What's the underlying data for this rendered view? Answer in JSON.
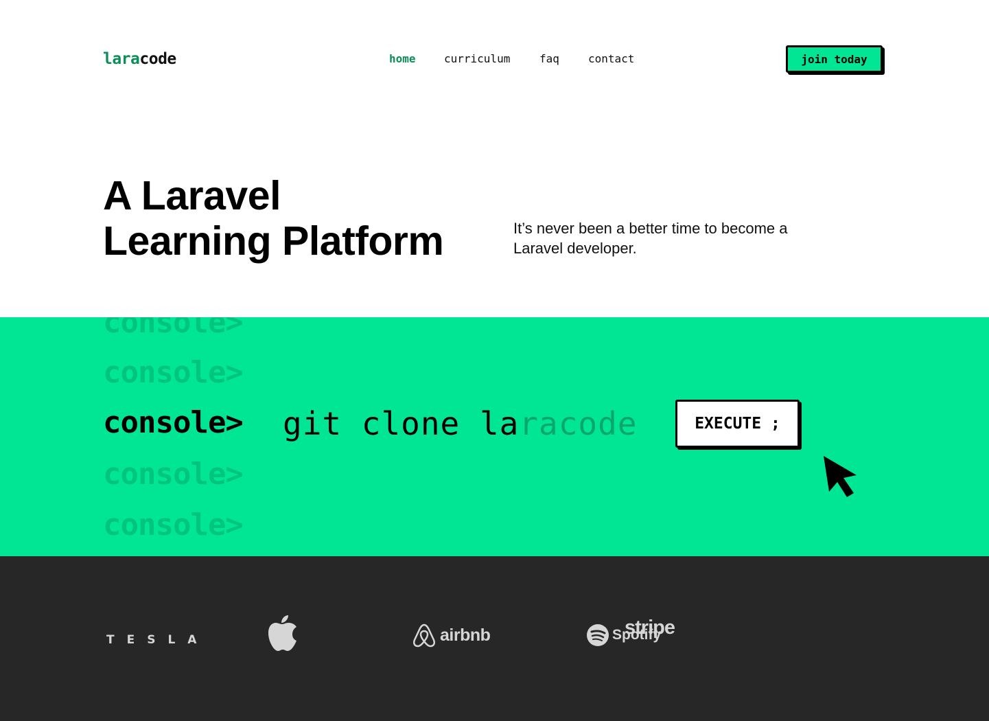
{
  "header": {
    "logo": {
      "part1": "lara",
      "part2": "code"
    },
    "nav": [
      {
        "label": "home",
        "active": true
      },
      {
        "label": "curriculum",
        "active": false
      },
      {
        "label": "faq",
        "active": false
      },
      {
        "label": "contact",
        "active": false
      }
    ],
    "cta_label": "join today"
  },
  "hero": {
    "title_line1": "A Laravel",
    "title_line2": "Learning Platform",
    "subtitle": "It’s never been a better time to become a Laravel developer."
  },
  "console": {
    "ghost_prompt": "console>",
    "prompt": "console>",
    "command_typed": "git clone la",
    "command_rest": "racode",
    "execute_label": "EXECUTE ;"
  },
  "brands": {
    "tesla": "TESLA",
    "apple": "apple-logo",
    "airbnb": "airbnb",
    "spotify": "Spotify",
    "stripe": "stripe"
  },
  "colors": {
    "accent": "#00e695",
    "accent_dark": "#0b8f58",
    "dark_band": "#272727",
    "logo_gray": "#d6d6d6"
  }
}
